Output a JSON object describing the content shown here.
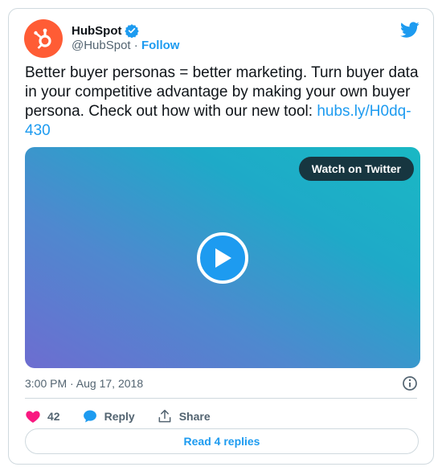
{
  "author": {
    "name": "HubSpot",
    "handle": "@HubSpot",
    "separator": "·",
    "follow_label": "Follow"
  },
  "tweet": {
    "text": "Better buyer personas = better marketing. Turn buyer data in your competitive advantage by making your own buyer persona. Check out how with our new tool: ",
    "link_text": "hubs.ly/H0dq-430"
  },
  "media": {
    "watch_label": "Watch on Twitter"
  },
  "meta": {
    "timestamp": "3:00 PM · Aug 17, 2018"
  },
  "actions": {
    "like_count": "42",
    "reply_label": "Reply",
    "share_label": "Share"
  },
  "footer": {
    "read_replies_label": "Read 4 replies"
  },
  "colors": {
    "brand_hubspot": "#ff5c35",
    "twitter_blue": "#1d9bf0",
    "like_pink": "#f91880"
  },
  "icons": [
    "hubspot-logo-icon",
    "verified-badge-icon",
    "twitter-bird-icon",
    "play-icon",
    "info-icon",
    "heart-icon",
    "reply-icon",
    "share-icon"
  ]
}
